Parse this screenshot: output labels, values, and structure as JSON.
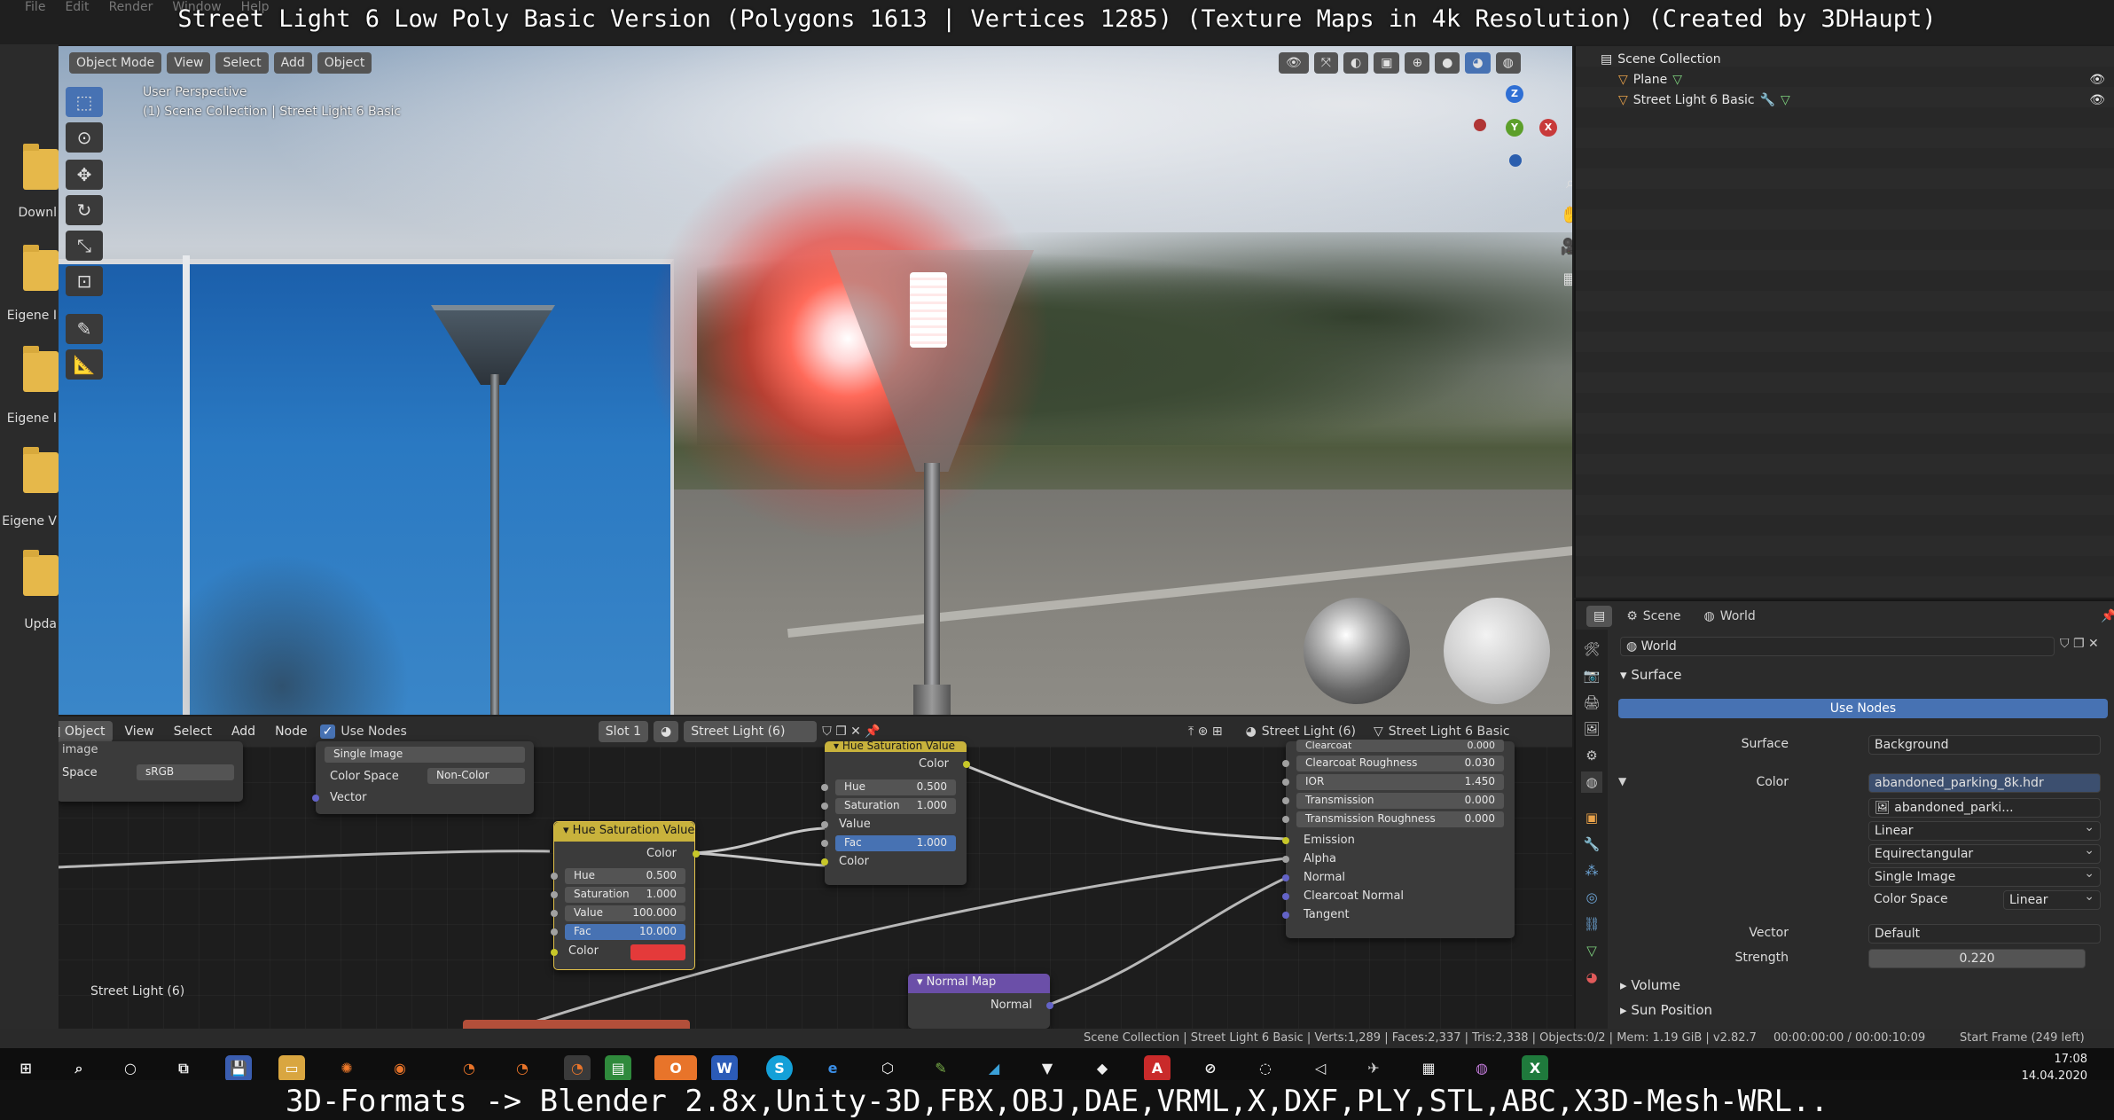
{
  "captions": {
    "top": "Street Light 6 Low Poly Basic Version (Polygons 1613 | Vertices 1285) (Texture Maps in 4k Resolution) (Created by 3DHaupt)",
    "bottom": "3D-Formats -> Blender 2.8x,Unity-3D,FBX,OBJ,DAE,VRML,X,DXF,PLY,STL,ABC,X3D-Mesh-WRL.."
  },
  "blender_menu": [
    "File",
    "Edit",
    "Render",
    "Window",
    "Help"
  ],
  "desktop": {
    "items": [
      {
        "label": "Downl"
      },
      {
        "label": "Eigene I"
      },
      {
        "label": "Eigene I"
      },
      {
        "label": "Eigene V"
      },
      {
        "label": "Upda"
      }
    ]
  },
  "viewport": {
    "mode": "Object Mode",
    "menus": [
      "View",
      "Select",
      "Add",
      "Object"
    ],
    "perspective": "User Perspective",
    "collection": "(1) Scene Collection | Street Light 6 Basic",
    "gizmo": {
      "z": "Z",
      "y": "Y",
      "x": "X"
    }
  },
  "outliner": {
    "root": "Scene Collection",
    "items": [
      {
        "name": "Plane"
      },
      {
        "name": "Street Light 6 Basic"
      }
    ]
  },
  "properties": {
    "breadcrumb_scene": "Scene",
    "breadcrumb_world": "World",
    "world_name": "World",
    "surface_panel": "Surface",
    "use_nodes": "Use Nodes",
    "surface_label": "Surface",
    "surface_value": "Background",
    "color_label": "Color",
    "color_value": "abandoned_parking_8k.hdr",
    "image_name": "abandoned_parki...",
    "interp": "Linear",
    "projection": "Equirectangular",
    "source": "Single Image",
    "colorspace_label": "Color Space",
    "colorspace_value": "Linear",
    "vector_label": "Vector",
    "vector_value": "Default",
    "strength_label": "Strength",
    "strength_value": "0.220",
    "volume_panel": "Volume",
    "sunpos_panel": "Sun Position"
  },
  "node_editor": {
    "header": {
      "object_menu": "Object",
      "menus": [
        "View",
        "Select",
        "Add",
        "Node"
      ],
      "use_nodes": "Use Nodes",
      "slot": "Slot 1",
      "material": "Street Light (6)",
      "material2": "Street Light (6)",
      "object_name": "Street Light 6 Basic"
    },
    "frame_label": "Street Light (6)",
    "left_node": {
      "image_label": "image",
      "space_label": "Space",
      "space_value": "sRGB"
    },
    "img_node": {
      "source": "Single Image",
      "cs_label": "Color Space",
      "cs_value": "Non-Color",
      "vector": "Vector"
    },
    "hsv1": {
      "title": "Hue Saturation Value",
      "out": "Color",
      "hue": "Hue",
      "hue_v": "0.500",
      "sat": "Saturation",
      "sat_v": "1.000",
      "val": "Value",
      "val_v": "100.000",
      "fac": "Fac",
      "fac_v": "10.000",
      "color": "Color"
    },
    "hsv2": {
      "title": "Hue Saturation Value",
      "out": "Color",
      "hue": "Hue",
      "hue_v": "0.500",
      "sat": "Saturation",
      "sat_v": "1.000",
      "val": "Value",
      "fac": "Fac",
      "fac_v": "1.000",
      "color": "Color"
    },
    "bsdf": {
      "rows": [
        {
          "label": "Clearcoat",
          "value": "0.000"
        },
        {
          "label": "Clearcoat Roughness",
          "value": "0.030"
        },
        {
          "label": "IOR",
          "value": "1.450"
        },
        {
          "label": "Transmission",
          "value": "0.000"
        },
        {
          "label": "Transmission Roughness",
          "value": "0.000"
        }
      ],
      "inputs": [
        "Emission",
        "Alpha",
        "Normal",
        "Clearcoat Normal",
        "Tangent"
      ]
    },
    "normal_map": {
      "title": "Normal Map",
      "out": "Normal"
    }
  },
  "statusbar": {
    "stats": "Scene Collection | Street Light 6 Basic | Verts:1,289 | Faces:2,337 | Tris:2,338 | Objects:0/2 | Mem: 1.19 GiB | v2.82.7",
    "time": "00:00:00:00 / 00:00:10:09",
    "frame": "Start Frame (249 left)"
  },
  "clock": {
    "time": "17:08",
    "date": "14.04.2020"
  },
  "colors": {
    "accent": "#4772b3",
    "hsv_header": "#c8b23c",
    "normal_header": "#6b4fa8",
    "glow": "#ff5a4a"
  }
}
